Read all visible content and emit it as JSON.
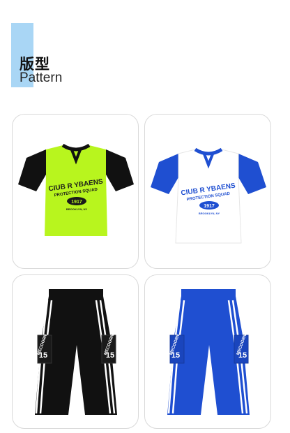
{
  "header": {
    "title_cn": "版型",
    "title_en": "Pattern",
    "accent_color": "#a9d6f5"
  },
  "products": [
    {
      "type": "t-shirt",
      "body_color": "#b8f51e",
      "sleeve_color": "#111111",
      "print_color": "#1a1a1a",
      "print_line1": "CIUB R YBAENS",
      "print_line2": "PROTECTION SQUAD",
      "badge": "1917",
      "print_small": "BROOKLYN, NY"
    },
    {
      "type": "t-shirt",
      "body_color": "#ffffff",
      "sleeve_color": "#1f4fd1",
      "print_color": "#1f4fd1",
      "print_line1": "CIUB R YBAENS",
      "print_line2": "PROTECTION SQUAD",
      "badge": "1917",
      "print_small": "BROOKLYN, NY"
    },
    {
      "type": "cargo-pants",
      "body_color": "#111111",
      "stripe_color": "#ffffff",
      "pocket_text": "MECOGRN",
      "pocket_number": "15"
    },
    {
      "type": "cargo-pants",
      "body_color": "#1f4fd1",
      "stripe_color": "#ffffff",
      "pocket_text": "MECOGRN",
      "pocket_number": "15"
    }
  ]
}
